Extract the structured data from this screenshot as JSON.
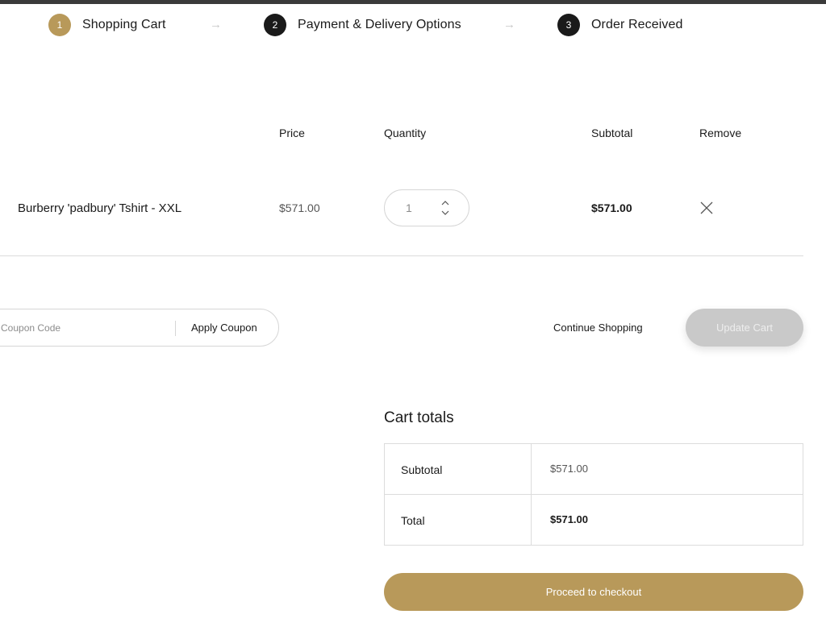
{
  "steps": [
    {
      "number": "1",
      "label": "Shopping Cart"
    },
    {
      "number": "2",
      "label": "Payment & Delivery Options"
    },
    {
      "number": "3",
      "label": "Order Received"
    }
  ],
  "cart_table": {
    "headers": {
      "price": "Price",
      "quantity": "Quantity",
      "subtotal": "Subtotal",
      "remove": "Remove"
    },
    "rows": [
      {
        "product": "Burberry 'padbury' Tshirt - XXL",
        "price": "$571.00",
        "quantity": "1",
        "subtotal": "$571.00"
      }
    ]
  },
  "coupon": {
    "placeholder": "Coupon Code",
    "apply_label": "Apply Coupon"
  },
  "actions": {
    "continue_label": "Continue Shopping",
    "update_label": "Update Cart"
  },
  "totals": {
    "title": "Cart totals",
    "subtotal_label": "Subtotal",
    "subtotal_value": "$571.00",
    "total_label": "Total",
    "total_value": "$571.00"
  },
  "checkout": {
    "label": "Proceed to checkout"
  },
  "colors": {
    "accent": "#b8995a",
    "dark": "#1a1a1a",
    "disabled": "#c9c9c9"
  }
}
